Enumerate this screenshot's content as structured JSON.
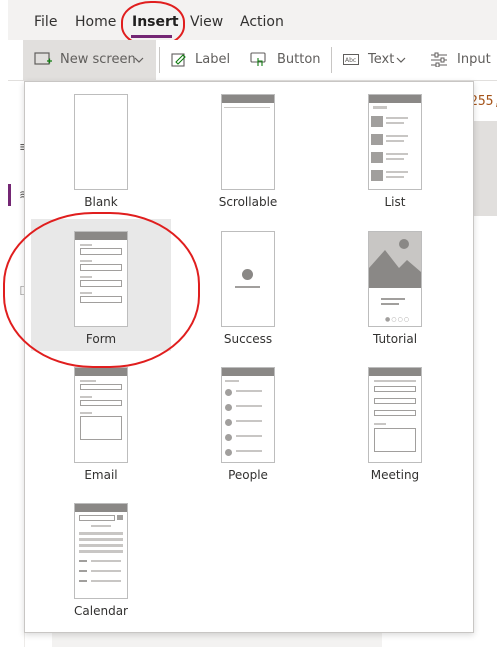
{
  "menubar": {
    "items": [
      {
        "label": "File",
        "active": false
      },
      {
        "label": "Home",
        "active": false
      },
      {
        "label": "Insert",
        "active": true
      },
      {
        "label": "View",
        "active": false
      },
      {
        "label": "Action",
        "active": false
      }
    ]
  },
  "ribbon": {
    "new_screen": "New screen",
    "label": "Label",
    "button": "Button",
    "text": "Text",
    "input": "Input"
  },
  "formula": {
    "text": "255,"
  },
  "screens": [
    {
      "label": "Blank"
    },
    {
      "label": "Scrollable"
    },
    {
      "label": "List"
    },
    {
      "label": "Form"
    },
    {
      "label": "Success"
    },
    {
      "label": "Tutorial"
    },
    {
      "label": "Email"
    },
    {
      "label": "People"
    },
    {
      "label": "Meeting"
    },
    {
      "label": "Calendar"
    }
  ],
  "colors": {
    "accent": "#742774",
    "annotation": "#e01e1e",
    "selected_tile": "#e8e8e8"
  },
  "icons": {
    "new_screen": "new-screen-icon",
    "label": "label-edit-icon",
    "button": "button-pointer-icon",
    "text": "text-abc-icon",
    "input": "input-sliders-icon"
  }
}
